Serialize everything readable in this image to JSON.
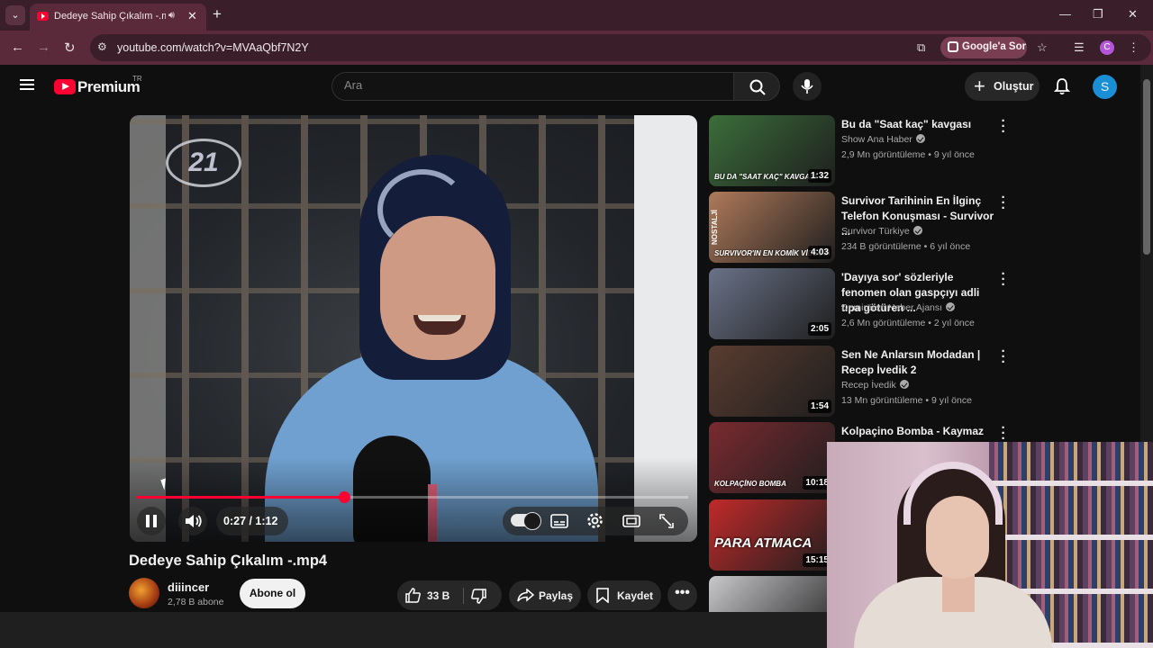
{
  "browser": {
    "tab_title": "Dedeye Sahip Çıkalım -.mp4",
    "url": "youtube.com/watch?v=MVAaQbf7N2Y",
    "ask_google_label": "Google'a Sor",
    "profile_initial": "C"
  },
  "header": {
    "logo_text": "Premium",
    "country_code": "TR",
    "search_placeholder": "Ara",
    "create_label": "Oluştur",
    "avatar_initial": "S"
  },
  "player": {
    "current_time": "0:27",
    "duration": "1:12",
    "time_display": "0:27 / 1:12",
    "progress_fraction": 0.375,
    "overlay_logo": "21"
  },
  "video": {
    "title": "Dedeye Sahip Çıkalım -.mp4",
    "channel": "diiincer",
    "subscribers": "2,78 B abone",
    "subscribe_label": "Abone ol",
    "likes": "33 B",
    "share_label": "Paylaş",
    "save_label": "Kaydet"
  },
  "recommendations": [
    {
      "title": "Bu da \"Saat kaç\" kavgası",
      "channel": "Show Ana Haber",
      "verified": true,
      "meta": "2,9 Mn görüntüleme • 9 yıl önce",
      "duration": "1:32",
      "thumb_caption": "BU DA \"SAAT KAÇ\" KAVGASI",
      "color": "#3b6e3a"
    },
    {
      "title": "Survivor Tarihinin En İlginç Telefon Konuşması - Survivor ...",
      "channel": "Survivor Türkiye",
      "verified": true,
      "meta": "234 B görüntüleme • 6 yıl önce",
      "duration": "4:03",
      "thumb_caption": "SURVIVOR'IN EN KOMİK VİDEOSU",
      "side_caption": "NOSTALJİ",
      "color": "#b07a5a"
    },
    {
      "title": "'Dayıya sor' sözleriyle fenomen olan gaspçıyı adli tıpa götüren ...",
      "channel": "Demirören Haber Ajansı",
      "verified": true,
      "meta": "2,6 Mn görüntüleme • 2 yıl önce",
      "duration": "2:05",
      "color": "#6a7288"
    },
    {
      "title": "Sen Ne Anlarsın Modadan | Recep İvedik 2",
      "channel": "Recep İvedik",
      "verified": true,
      "meta": "13 Mn görüntüleme • 9 yıl önce",
      "duration": "1:54",
      "color": "#5a3c30"
    },
    {
      "title": "Kolpaçino Bomba - Kaymaz",
      "channel": "",
      "verified": false,
      "meta": "",
      "duration": "10:18",
      "thumb_caption": "KOLPAÇİNO BOMBA",
      "color": "#7a2a30"
    },
    {
      "title": "",
      "channel": "",
      "verified": false,
      "meta": "",
      "duration": "15:15",
      "thumb_caption": "PARA ATMACA",
      "color": "#c12a2a"
    },
    {
      "title": "",
      "channel": "",
      "verified": false,
      "meta": "",
      "duration": "",
      "color": "#c9c9cc"
    }
  ]
}
